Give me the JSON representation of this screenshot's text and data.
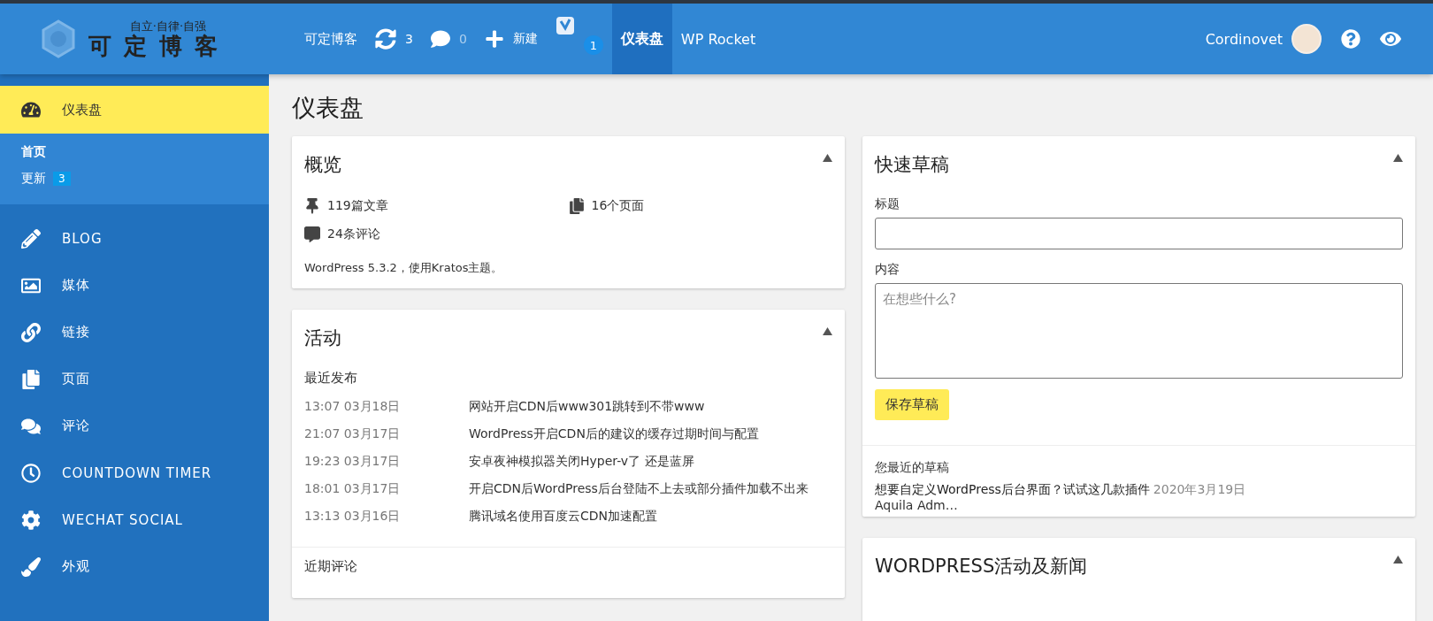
{
  "topbar": {
    "logo": {
      "motto": "自立·自律·自强",
      "name": "可定博客"
    },
    "items": [
      {
        "kind": "text",
        "label": "可定博客"
      },
      {
        "kind": "updates",
        "count": "3"
      },
      {
        "kind": "comments",
        "count": "0"
      },
      {
        "kind": "new",
        "label": "新建"
      },
      {
        "kind": "seo",
        "count": "1"
      },
      {
        "kind": "tab",
        "label": "仪表盘",
        "selected": true
      },
      {
        "kind": "tab",
        "label": "WP Rocket",
        "selected": false
      }
    ],
    "user": "Cordinovet"
  },
  "sidebar": {
    "items": [
      {
        "label": "仪表盘",
        "selected": true,
        "children": [
          {
            "label": "首页",
            "selected": true
          },
          {
            "label": "更新",
            "selected": false,
            "badge": "3"
          }
        ]
      },
      {
        "label": "BLOG",
        "selected": false
      },
      {
        "label": "媒体",
        "selected": false
      },
      {
        "label": "链接",
        "selected": false
      },
      {
        "label": "页面",
        "selected": false
      },
      {
        "label": "评论",
        "selected": false
      },
      {
        "label": "COUNTDOWN TIMER",
        "selected": false
      },
      {
        "label": "WECHAT SOCIAL",
        "selected": false
      },
      {
        "label": "外观",
        "selected": false
      }
    ]
  },
  "page_title": "仪表盘",
  "overview": {
    "title": "概览",
    "stats": [
      "119篇文章",
      "16个页面",
      "24条评论"
    ],
    "footer": "WordPress 5.3.2，使用Kratos主题。"
  },
  "activity": {
    "title": "活动",
    "section": "最近发布",
    "posts": [
      {
        "date": "13:07 03月18日",
        "title": "网站开启CDN后www301跳转到不带www"
      },
      {
        "date": "21:07 03月17日",
        "title": "WordPress开启CDN后的建议的缓存过期时间与配置"
      },
      {
        "date": "19:23 03月17日",
        "title": "安卓夜神模拟器关闭Hyper-v了 还是蓝屏"
      },
      {
        "date": "18:01 03月17日",
        "title": "开启CDN后WordPress后台登陆不上去或部分插件加载不出来"
      },
      {
        "date": "13:13 03月16日",
        "title": "腾讯域名使用百度云CDN加速配置"
      }
    ],
    "next_section": "近期评论"
  },
  "quick_draft": {
    "title": "快速草稿",
    "title_label": "标题",
    "content_label": "内容",
    "content_placeholder": "在想些什么?",
    "save_button": "保存草稿",
    "recent_label": "您最近的草稿",
    "drafts": [
      {
        "title": "想要自定义WordPress后台界面？试试这几款插件",
        "date": "2020年3月19日",
        "excerpt": "Aquila Adm…"
      }
    ]
  },
  "news": {
    "title": "WORDPRESS活动及新闻"
  }
}
